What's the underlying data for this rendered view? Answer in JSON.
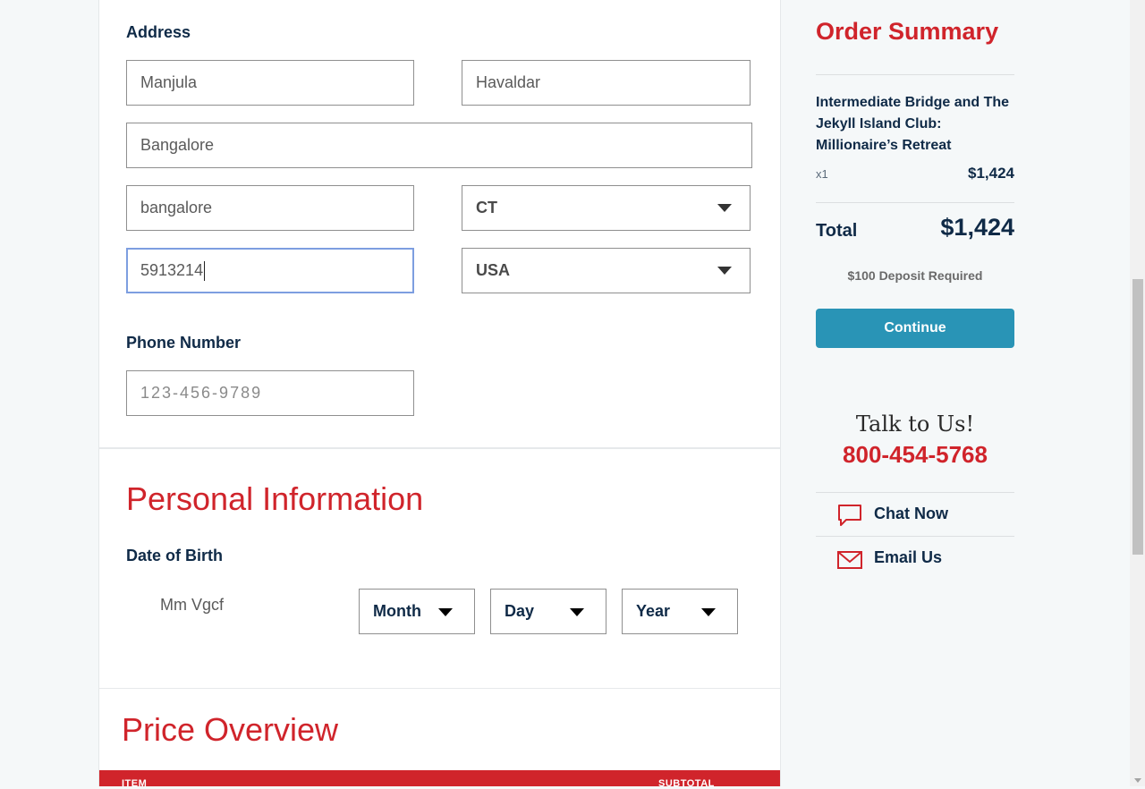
{
  "address": {
    "label": "Address",
    "first_name": "Manjula",
    "last_name": "Havaldar",
    "street": "Bangalore",
    "city": "bangalore",
    "state": "CT",
    "zip": "5913214",
    "country": "USA"
  },
  "phone": {
    "label": "Phone Number",
    "placeholder": "123-456-9789"
  },
  "personal": {
    "title": "Personal Information",
    "dob_label": "Date of Birth",
    "traveler_name": "Mm Vgcf",
    "month": "Month",
    "day": "Day",
    "year": "Year"
  },
  "price_overview": {
    "title": "Price Overview",
    "col_item": "ITEM",
    "col_subtotal": "SUBTOTAL"
  },
  "order_summary": {
    "title": "Order Summary",
    "item_name": "Intermediate Bridge and The Jekyll Island Club: Millionaire’s Retreat",
    "quantity": "x1",
    "item_price": "$1,424",
    "total_label": "Total",
    "total_value": "$1,424",
    "deposit": "$100 Deposit Required",
    "continue_label": "Continue"
  },
  "contact": {
    "talk": "Talk to Us!",
    "phone": "800-454-5768",
    "chat": "Chat Now",
    "email": "Email Us"
  },
  "colors": {
    "accent_red": "#d0242b",
    "navy": "#0f2a47",
    "button_blue": "#2994b6"
  }
}
